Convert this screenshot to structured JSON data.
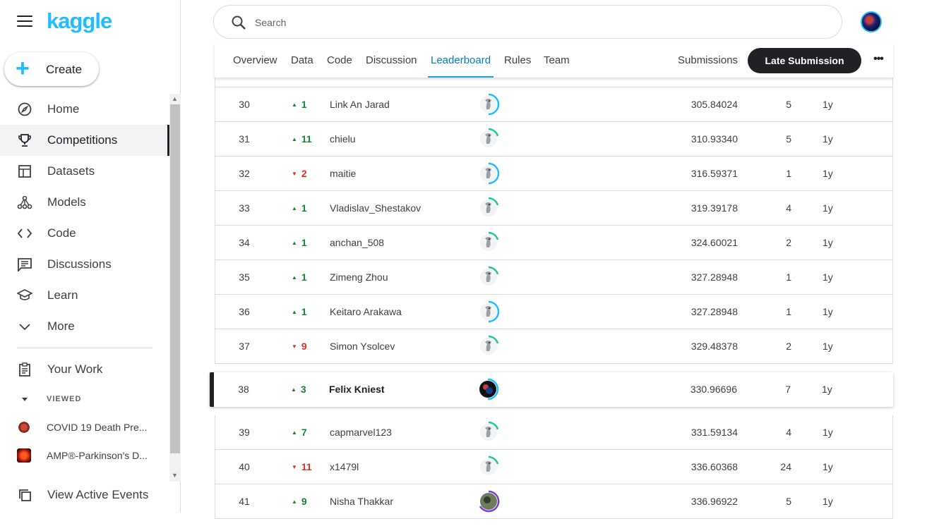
{
  "brand": {
    "logo_text": "kaggle",
    "accent": "#20beff"
  },
  "sidebar": {
    "create_label": "Create",
    "items": [
      {
        "label": "Home",
        "icon": "compass-icon"
      },
      {
        "label": "Competitions",
        "icon": "trophy-icon",
        "active": true
      },
      {
        "label": "Datasets",
        "icon": "table-icon"
      },
      {
        "label": "Models",
        "icon": "models-icon"
      },
      {
        "label": "Code",
        "icon": "code-icon"
      },
      {
        "label": "Discussions",
        "icon": "discussion-icon"
      },
      {
        "label": "Learn",
        "icon": "school-icon"
      },
      {
        "label": "More",
        "icon": "chevron-down-icon"
      }
    ],
    "your_work_label": "Your Work",
    "viewed_label": "VIEWED",
    "recent": [
      {
        "label": "COVID 19 Death Pre..."
      },
      {
        "label": "AMP®-Parkinson's D..."
      }
    ],
    "active_events_label": "View Active Events"
  },
  "search": {
    "placeholder": "Search"
  },
  "tabs": {
    "items": [
      "Overview",
      "Data",
      "Code",
      "Discussion",
      "Leaderboard",
      "Rules",
      "Team"
    ],
    "active": "Leaderboard",
    "submissions_label": "Submissions",
    "late_submission_label": "Late Submission"
  },
  "leaderboard": {
    "rows": [
      {
        "rank": "30",
        "dir": "up",
        "change": "1",
        "name": "Link An Jarad",
        "score": "305.84024",
        "entries": "5",
        "last": "1y"
      },
      {
        "rank": "31",
        "dir": "up",
        "change": "11",
        "name": "chielu",
        "score": "310.93340",
        "entries": "5",
        "last": "1y"
      },
      {
        "rank": "32",
        "dir": "down",
        "change": "2",
        "name": "maitie",
        "score": "316.59371",
        "entries": "1",
        "last": "1y"
      },
      {
        "rank": "33",
        "dir": "up",
        "change": "1",
        "name": "Vladislav_Shestakov",
        "score": "319.39178",
        "entries": "4",
        "last": "1y"
      },
      {
        "rank": "34",
        "dir": "up",
        "change": "1",
        "name": "anchan_508",
        "score": "324.60021",
        "entries": "2",
        "last": "1y"
      },
      {
        "rank": "35",
        "dir": "up",
        "change": "1",
        "name": "Zimeng Zhou",
        "score": "327.28948",
        "entries": "1",
        "last": "1y"
      },
      {
        "rank": "36",
        "dir": "up",
        "change": "1",
        "name": "Keitaro Arakawa",
        "score": "327.28948",
        "entries": "1",
        "last": "1y"
      },
      {
        "rank": "37",
        "dir": "down",
        "change": "9",
        "name": "Simon Ysolcev",
        "score": "329.48378",
        "entries": "2",
        "last": "1y"
      }
    ],
    "me": {
      "rank": "38",
      "dir": "up",
      "change": "3",
      "name": "Felix Kniest",
      "score": "330.96696",
      "entries": "7",
      "last": "1y"
    },
    "rows_after": [
      {
        "rank": "39",
        "dir": "up",
        "change": "7",
        "name": "capmarvel123",
        "score": "331.59134",
        "entries": "4",
        "last": "1y"
      },
      {
        "rank": "40",
        "dir": "down",
        "change": "11",
        "name": "x1479l",
        "score": "336.60368",
        "entries": "24",
        "last": "1y"
      },
      {
        "rank": "41",
        "dir": "up",
        "change": "9",
        "name": "Nisha Thakkar",
        "score": "336.96922",
        "entries": "5",
        "last": "1y"
      }
    ]
  }
}
